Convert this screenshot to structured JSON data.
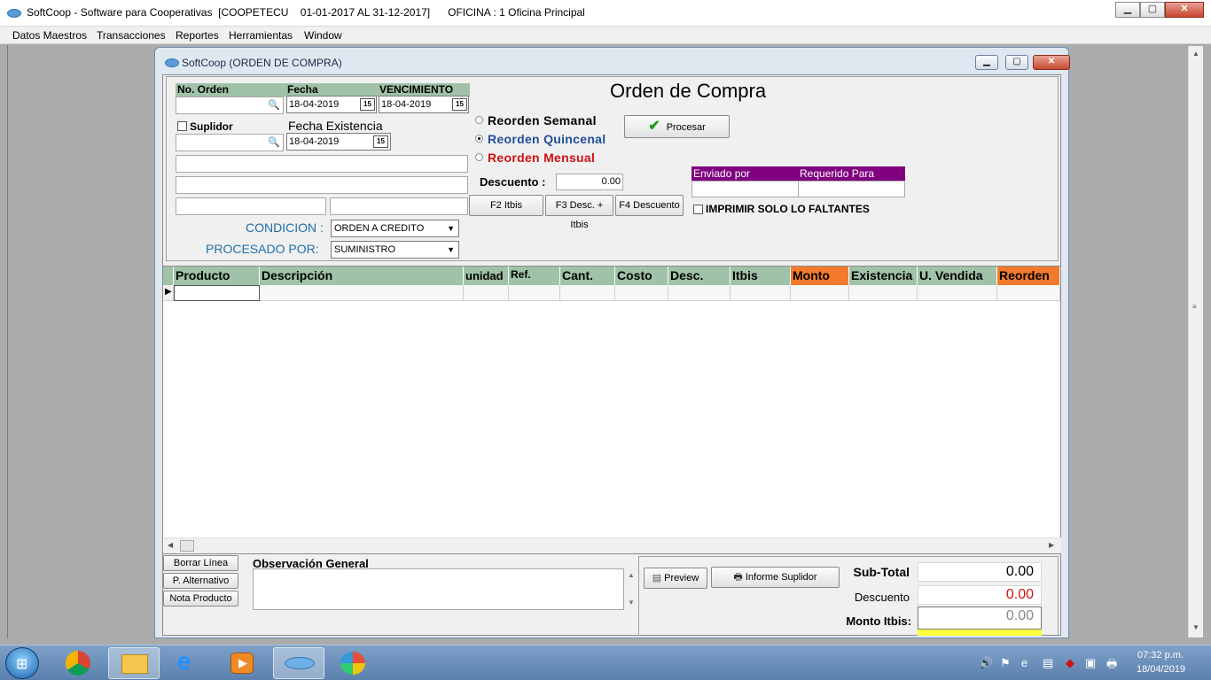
{
  "app": {
    "title": "SoftCoop - Software para Cooperativas  [COOPETECU    01-01-2017 AL 31-12-2017]      OFICINA : 1 Oficina Principal",
    "minimize": "▁",
    "maximize": "▢",
    "close": "✕"
  },
  "menu": [
    "Datos Maestros",
    "Transacciones",
    "Reportes",
    "Herramientas",
    "Window"
  ],
  "child": {
    "title": "SoftCoop (ORDEN DE COMPRA)"
  },
  "form": {
    "heading": "Orden de Compra",
    "no_orden_label": "No. Orden",
    "fecha_label": "Fecha",
    "vencimiento_label": "VENCIMIENTO",
    "fecha_value": "18-04-2019",
    "vencimiento_value": "18-04-2019",
    "suplidor_label": "Suplidor",
    "fecha_existencia_label": "Fecha Existencia",
    "fecha_existencia_value": "18-04-2019",
    "calendar_glyph": "15",
    "lookup_glyph": "🔍",
    "radios": [
      {
        "label": "Reorden Semanal",
        "color": "#000000",
        "checked": false
      },
      {
        "label": "Reorden Quincenal",
        "color": "#1f4e99",
        "checked": true
      },
      {
        "label": "Reorden Mensual",
        "color": "#d01010",
        "checked": false
      }
    ],
    "procesar_label": "Procesar",
    "descuento_label": "Descuento :",
    "descuento_value": "0.00",
    "f2_label": "F2 Itbis",
    "f3_label": "F3 Desc. + Itbis",
    "f4_label": "F4 Descuento",
    "enviado_por_label": "Enviado por",
    "requerido_para_label": "Requerido Para",
    "imprimir_label": "IMPRIMIR SOLO LO FALTANTES",
    "condicion_label": "CONDICION :",
    "condicion_value": "ORDEN A CREDITO",
    "procesado_label": "PROCESADO POR:",
    "procesado_value": "SUMINISTRO",
    "accent_teal": "#1f6fa8",
    "accent_purple": "#800080"
  },
  "grid": {
    "columns": [
      "Producto",
      "Descripción",
      "unidad",
      "Ref.",
      "Cant.",
      "Costo",
      "Desc.",
      "Itbis",
      "Monto",
      "Existencia",
      "U. Vendida",
      "Reorden"
    ]
  },
  "bottom": {
    "borrar_linea": "Borrar Línea",
    "p_alternativo": "P. Alternativo",
    "nota_producto": "Nota Producto",
    "observacion_label": "Observación General",
    "preview_label": "Preview",
    "informe_label": "Informe Suplidor",
    "subtotal_label": "Sub-Total",
    "subtotal_value": "0.00",
    "descuento_label": "Descuento",
    "descuento_value": "0.00",
    "itbis_label": "Monto Itbis:",
    "itbis_value": "0.00"
  },
  "taskbar": {
    "time": "07:32 p.m.",
    "date": "18/04/2019"
  }
}
